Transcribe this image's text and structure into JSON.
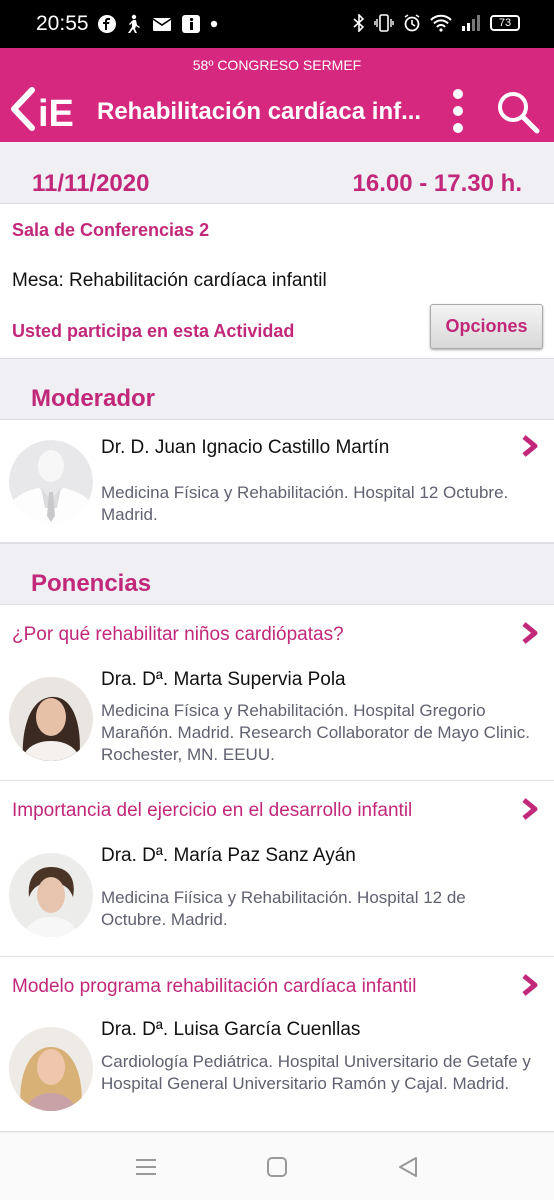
{
  "status_bar": {
    "time": "20:55",
    "battery": "73"
  },
  "header": {
    "congress": "58º CONGRESO SERMEF",
    "logo_text": "iE",
    "title": "Rehabilitación cardíaca inf..."
  },
  "session": {
    "date": "11/11/2020",
    "hours": "16.00 - 17.30 h.",
    "room": "Sala de Conferencias 2",
    "mesa": "Mesa: Rehabilitación cardíaca infantil",
    "participation": "Usted participa en esta Actividad",
    "options_label": "Opciones"
  },
  "moderator_section": {
    "heading": "Moderador",
    "name": "Dr. D. Juan Ignacio Castillo Martín",
    "affiliation": "Medicina Física y Rehabilitación. Hospital 12 Octubre. Madrid."
  },
  "talks_section": {
    "heading": "Ponencias",
    "talks": [
      {
        "title": "¿Por qué rehabilitar niños cardiópatas?",
        "speaker": "Dra. Dª. Marta Supervia Pola",
        "affiliation": "Medicina Física y Rehabilitación. Hospital Gregorio Marañón. Madrid. Research Collaborator de Mayo Clinic. Rochester, MN. EEUU."
      },
      {
        "title": "Importancia del ejercicio en el desarrollo infantil",
        "speaker": "Dra. Dª. María Paz Sanz Ayán",
        "affiliation": "Medicina Fiísica y Rehabilitación. Hospital 12 de Octubre. Madrid."
      },
      {
        "title": "Modelo programa rehabilitación cardíaca infantil",
        "speaker": "Dra. Dª. Luisa García Cuenllas",
        "affiliation": "Cardiología Pediátrica. Hospital Universitario de Getafe y Hospital General Universitario Ramón y Cajal. Madrid."
      }
    ]
  },
  "colors": {
    "brand": "#d6287f",
    "accent_text": "#c2287a",
    "section_bg": "#efeff4"
  },
  "icons": [
    "facebook-icon",
    "accessibility-icon",
    "mail-icon",
    "info-icon",
    "bluetooth-icon",
    "vibrate-icon",
    "alarm-icon",
    "wifi-icon",
    "signal-icon",
    "back-icon",
    "more-vertical-icon",
    "search-icon",
    "chevron-right-icon",
    "menu-icon",
    "home-icon",
    "back-triangle-icon"
  ]
}
